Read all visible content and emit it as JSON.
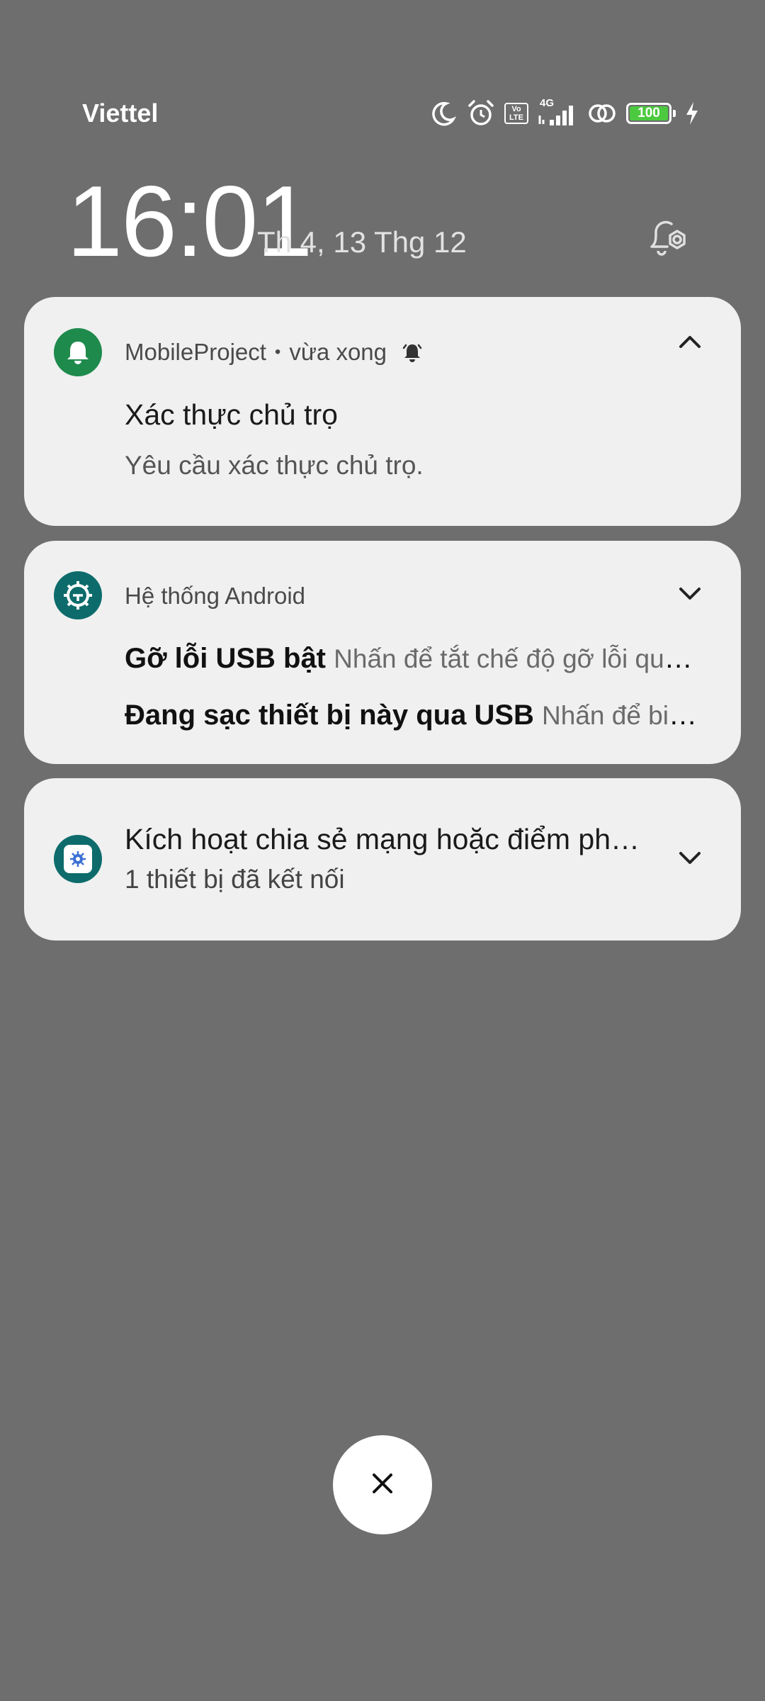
{
  "status_bar": {
    "carrier": "Viettel",
    "network_label": "4G",
    "volte_top": "Vo",
    "volte_bottom": "LTE",
    "battery_level": "100",
    "battery_color": "#4cc93f",
    "icons": [
      "moon-icon",
      "alarm-icon",
      "volte-icon",
      "signal-icon",
      "hotspot-icon",
      "battery-icon",
      "charging-icon"
    ]
  },
  "lockscreen": {
    "time": "16:01",
    "date": "Th 4, 13 Thg 12"
  },
  "notifications": [
    {
      "app": "MobileProject",
      "time": "vừa xong",
      "title": "Xác thực chủ trọ",
      "body": "Yêu cầu xác thực chủ trọ.",
      "icon": "bell-icon",
      "icon_color": "#1e8a4c",
      "expanded": true
    },
    {
      "app": "Hệ thống Android",
      "icon": "android-system-icon",
      "icon_color": "#0d6b6b",
      "expanded": false,
      "rows": [
        {
          "title": "Gỡ lỗi USB bật",
          "text": "Nhấn để tắt chế độ gỡ lỗi qua USB"
        },
        {
          "title": "Đang sạc thiết bị này qua USB",
          "text": "Nhấn để biết thêm tùy chọn"
        }
      ]
    },
    {
      "title": "Kích hoạt chia sẻ mạng hoặc điểm phát sóng",
      "body": "1 thiết bị đã kết nối",
      "icon": "tethering-icon",
      "icon_color": "#0d6b6b",
      "expanded": false
    }
  ],
  "colors": {
    "background": "#6e6e6e",
    "card": "#f0f0f0"
  }
}
